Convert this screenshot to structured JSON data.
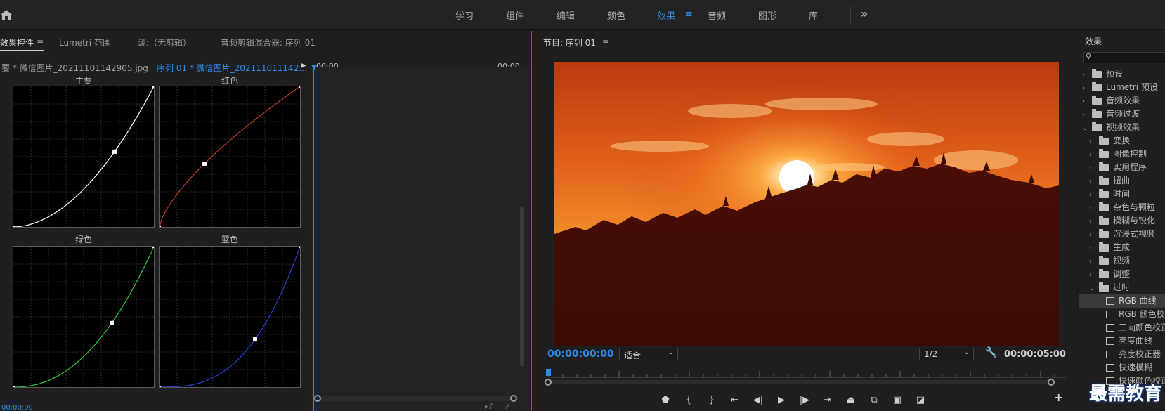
{
  "workspace": {
    "tabs": [
      "学习",
      "组件",
      "编辑",
      "颜色",
      "效果",
      "音频",
      "图形",
      "库"
    ],
    "active_tab": "效果",
    "more_label": "»",
    "menu_label": "≡"
  },
  "left_panel": {
    "tabs": {
      "effect_controls": "效果控件",
      "lumetri_scopes": "Lumetri 范围",
      "source": "源:（无剪辑）",
      "audio_mixer": "音频剪辑混合器: 序列 01"
    },
    "menu_label": "≡",
    "clip_source": "要 * 微信图片_20211101142905.jpg",
    "clip_sequence": "序列 01 * 微信图片_202111011142...",
    "timeline_start": "00:00",
    "timeline_end": "00:00",
    "bottom_timecode": "00:00:00",
    "curves": [
      {
        "label": "主要",
        "color": "#ffffff",
        "shape": "master"
      },
      {
        "label": "红色",
        "color": "#c0392b",
        "shape": "red"
      },
      {
        "label": "绿色",
        "color": "#2ecc40",
        "shape": "green"
      },
      {
        "label": "蓝色",
        "color": "#2c3fd6",
        "shape": "blue"
      }
    ]
  },
  "program_monitor": {
    "title": "节目: 序列 01",
    "menu_label": "≡",
    "current_timecode": "00:00:00:00",
    "fit_option": "适合",
    "resolution": "1/2",
    "duration": "00:00:05:00"
  },
  "effects_panel": {
    "title": "效果",
    "items": [
      {
        "label": "预设",
        "level": 0,
        "icon": "folder",
        "expanded": false
      },
      {
        "label": "Lumetri 预设",
        "level": 0,
        "icon": "folder",
        "expanded": false
      },
      {
        "label": "音频效果",
        "level": 0,
        "icon": "folder",
        "expanded": false
      },
      {
        "label": "音频过渡",
        "level": 0,
        "icon": "folder",
        "expanded": false
      },
      {
        "label": "视频效果",
        "level": 0,
        "icon": "folder",
        "expanded": true
      },
      {
        "label": "变换",
        "level": 1,
        "icon": "folder",
        "expanded": false
      },
      {
        "label": "图像控制",
        "level": 1,
        "icon": "folder",
        "expanded": false
      },
      {
        "label": "实用程序",
        "level": 1,
        "icon": "folder",
        "expanded": false
      },
      {
        "label": "扭曲",
        "level": 1,
        "icon": "folder",
        "expanded": false
      },
      {
        "label": "时间",
        "level": 1,
        "icon": "folder",
        "expanded": false
      },
      {
        "label": "杂色与颗粒",
        "level": 1,
        "icon": "folder",
        "expanded": false
      },
      {
        "label": "模糊与锐化",
        "level": 1,
        "icon": "folder",
        "expanded": false
      },
      {
        "label": "沉浸式视频",
        "level": 1,
        "icon": "folder",
        "expanded": false
      },
      {
        "label": "生成",
        "level": 1,
        "icon": "folder",
        "expanded": false
      },
      {
        "label": "视频",
        "level": 1,
        "icon": "folder",
        "expanded": false
      },
      {
        "label": "调整",
        "level": 1,
        "icon": "folder",
        "expanded": false
      },
      {
        "label": "过时",
        "level": 1,
        "icon": "folder",
        "expanded": true
      },
      {
        "label": "RGB 曲线",
        "level": 2,
        "icon": "effect",
        "selected": true
      },
      {
        "label": "RGB 颜色校正器",
        "level": 2,
        "icon": "effect"
      },
      {
        "label": "三向颜色校正器",
        "level": 2,
        "icon": "effect"
      },
      {
        "label": "亮度曲线",
        "level": 2,
        "icon": "effect"
      },
      {
        "label": "亮度校正器",
        "level": 2,
        "icon": "effect"
      },
      {
        "label": "快速模糊",
        "level": 2,
        "icon": "effect"
      },
      {
        "label": "快速颜色校正器",
        "level": 2,
        "icon": "effect"
      }
    ]
  },
  "watermark": "最需教育"
}
